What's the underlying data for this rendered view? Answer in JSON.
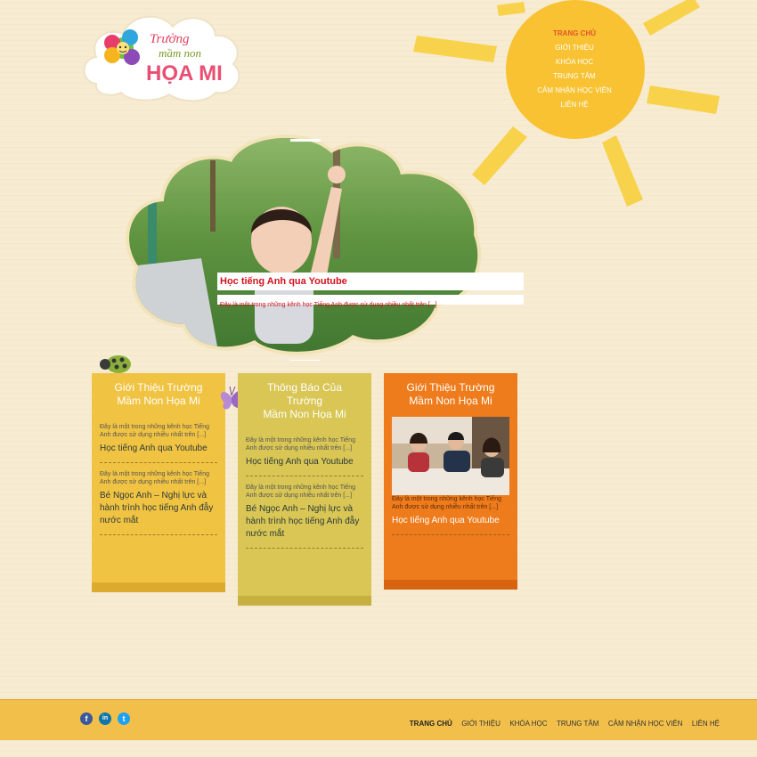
{
  "logo": {
    "line1": "Trường",
    "line2": "mầm non",
    "line3": "HỌA MI"
  },
  "nav": {
    "items": [
      "TRANG CHỦ",
      "GIỚI THIỆU",
      "KHÓA HỌC",
      "TRUNG TÂM",
      "CẢM NHẬN HỌC VIÊN",
      "LIÊN HỆ"
    ],
    "active_index": 0
  },
  "slider": {
    "title": "Học tiếng Anh qua Youtube",
    "description": "Đây là một trong những kênh học Tiếng Anh được sử dụng nhiều nhất trên [...]"
  },
  "columns": [
    {
      "heading": [
        "Giới Thiệu Trường",
        "Mầm Non Họa Mi"
      ],
      "items": [
        {
          "excerpt": "Đây là một trong những kênh học Tiếng Anh được sử dụng nhiều nhất trên [...]",
          "title": "Học tiếng Anh qua Youtube"
        },
        {
          "excerpt": "Đây là một trong những kênh học Tiếng Anh được sử dụng nhiều nhất trên [...]",
          "title": "Bé Ngọc Anh – Nghị lực và hành trình học tiếng Anh đẫy nước mắt"
        }
      ]
    },
    {
      "heading": [
        "Thông Báo Của",
        "Trường",
        "Mầm Non Họa Mi"
      ],
      "items": [
        {
          "excerpt": "Đây là một trong những kênh học Tiếng Anh được sử dụng nhiều nhất trên [...]",
          "title": "Học tiếng Anh qua Youtube"
        },
        {
          "excerpt": "Đây là một trong những kênh học Tiếng Anh được sử dụng nhiều nhất trên [...]",
          "title": "Bé Ngọc Anh – Nghị lực và hành trình học tiếng Anh đẫy nước mắt"
        }
      ]
    },
    {
      "heading": [
        "Giới Thiệu Trường",
        "Mầm Non Họa Mi"
      ],
      "items": [
        {
          "excerpt": "Đây là một trong những kênh học Tiếng Anh được sử dụng nhiều nhất trên [...]",
          "title": "Học tiếng Anh qua Youtube"
        }
      ]
    }
  ],
  "footer": {
    "social": [
      {
        "name": "facebook-icon",
        "glyph": "f",
        "color": "#3b5998"
      },
      {
        "name": "linkedin-icon",
        "glyph": "in",
        "color": "#0e76a8"
      },
      {
        "name": "twitter-icon",
        "glyph": "t",
        "color": "#1da1f2"
      }
    ],
    "nav": [
      "TRANG CHỦ",
      "GIỚI THIỆU",
      "KHÓA HỌC",
      "TRUNG TÂM",
      "CẢM NHẬN HỌC VIÊN",
      "LIÊN HỆ"
    ]
  },
  "colors": {
    "sun": "#f8c232",
    "col1": "#f1c342",
    "col2": "#d9c655",
    "col3": "#ef7c1c",
    "caption_red": "#d4111d",
    "footer": "#f2c04a"
  }
}
